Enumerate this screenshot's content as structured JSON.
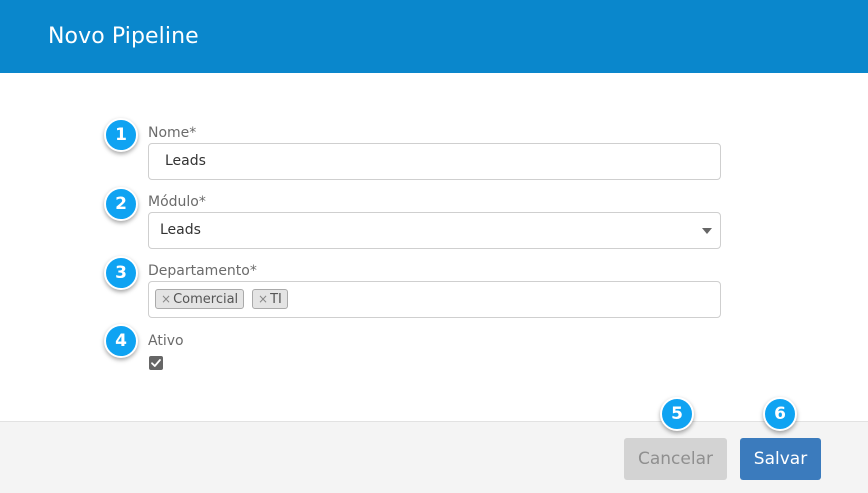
{
  "dialog": {
    "title": "Novo Pipeline"
  },
  "steps": [
    "1",
    "2",
    "3",
    "4",
    "5",
    "6"
  ],
  "fields": {
    "nome": {
      "label": "Nome*",
      "value": "Leads"
    },
    "modulo": {
      "label": "Módulo*",
      "value": "Leads"
    },
    "departamento": {
      "label": "Departamento*",
      "tags": [
        "Comercial",
        "TI"
      ],
      "remove_glyph": "×"
    },
    "ativo": {
      "label": "Ativo",
      "checked": true
    }
  },
  "footer": {
    "cancel_label": "Cancelar",
    "save_label": "Salvar"
  },
  "colors": {
    "header_bg": "#0a87cc",
    "badge_bg": "#0fa3f2",
    "save_bg": "#3b7bbd",
    "cancel_bg": "#d3d3d3"
  },
  "icons": {
    "select_caret": "chevron-down-icon",
    "checkbox": "check-icon",
    "tag_remove": "close-icon"
  }
}
